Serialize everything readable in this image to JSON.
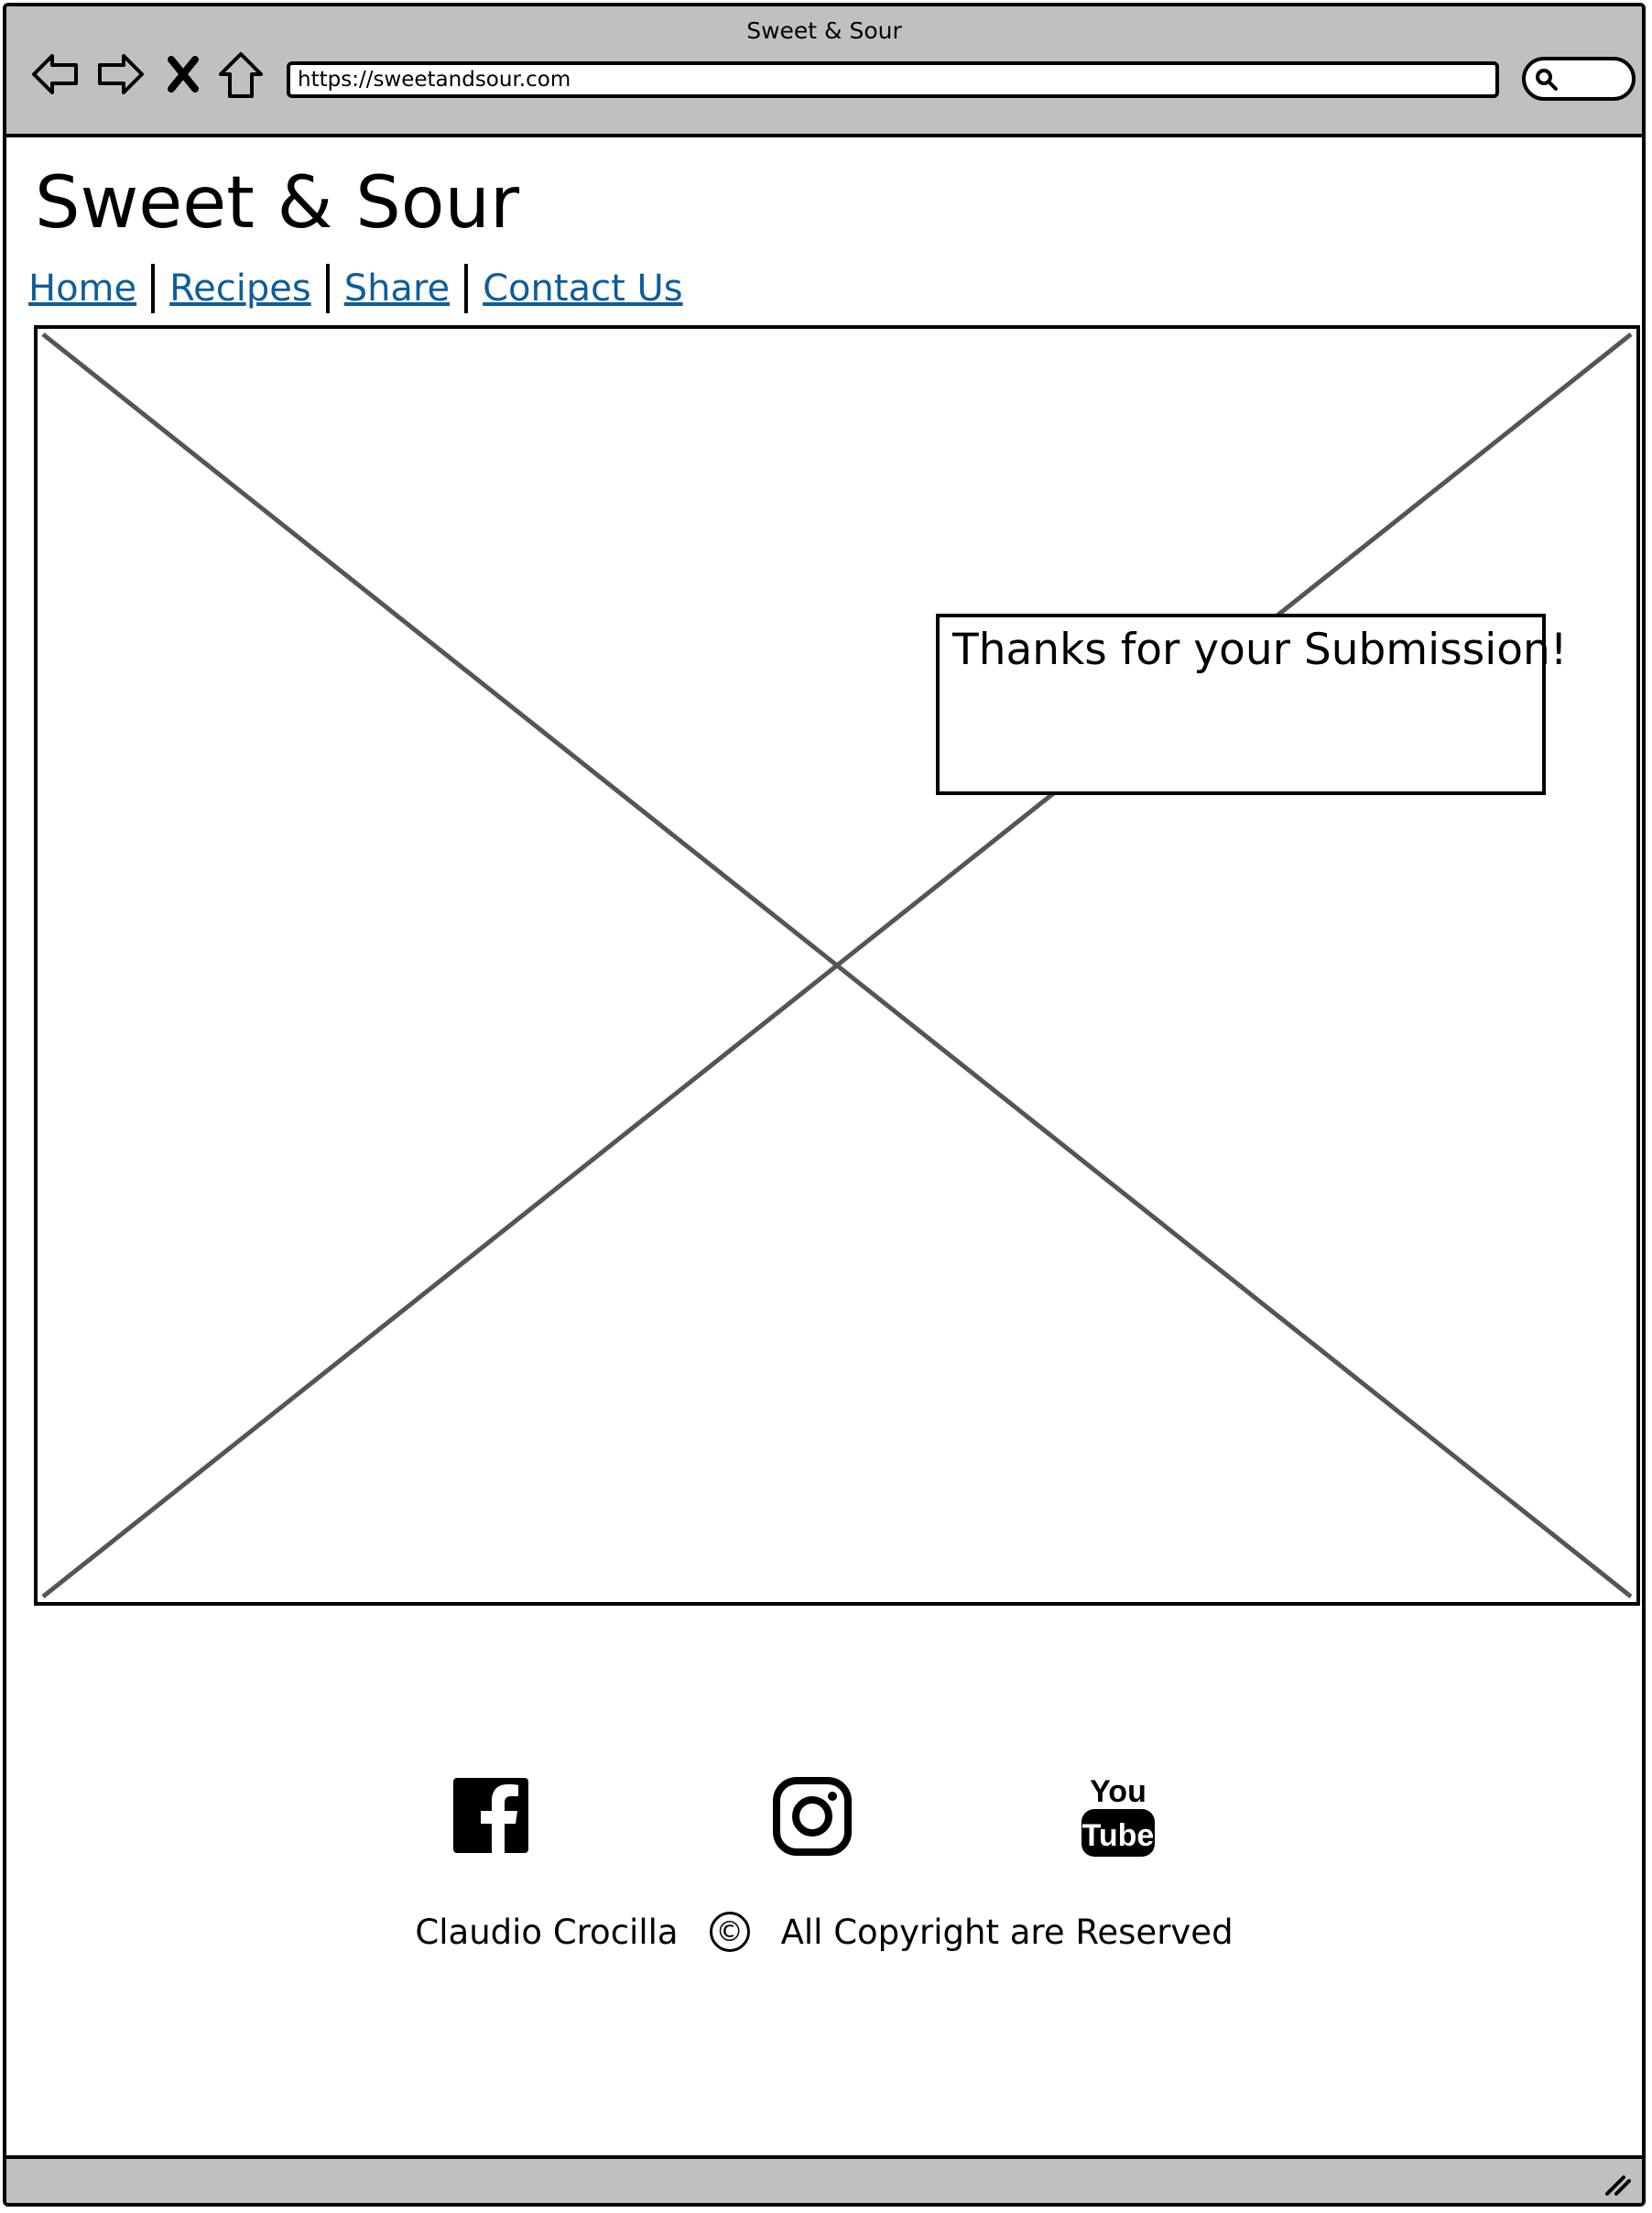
{
  "browser": {
    "window_title": "Sweet & Sour",
    "url": "https://sweetandsour.com",
    "icons": [
      "back-arrow-icon",
      "forward-arrow-icon",
      "close-x-icon",
      "home-icon",
      "search-icon",
      "resize-grip-icon"
    ]
  },
  "page": {
    "site_title": "Sweet & Sour",
    "nav": {
      "home": "Home",
      "recipes": "Recipes",
      "share": "Share",
      "contact": "Contact Us"
    },
    "hero": {
      "type": "image-placeholder"
    },
    "notice": {
      "message": "Thanks for your Submission!"
    },
    "social": [
      "facebook-icon",
      "instagram-icon",
      "youtube-icon"
    ],
    "footer": {
      "author": "Claudio Crocilla",
      "copyright_symbol": "©",
      "rights": "All Copyright are Reserved"
    }
  },
  "colors": {
    "chrome": "#c0c0c0",
    "link": "#0d5d9c",
    "placeholder_lines": "#555555"
  }
}
